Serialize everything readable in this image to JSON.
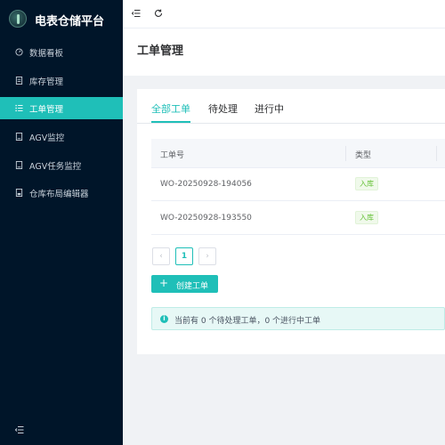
{
  "app": {
    "title": "电表仓储平台"
  },
  "sidebar": {
    "items": [
      {
        "label": "数据看板",
        "icon": "dashboard-icon",
        "active": false
      },
      {
        "label": "库存管理",
        "icon": "inventory-icon",
        "active": false
      },
      {
        "label": "工单管理",
        "icon": "list-icon",
        "active": true
      },
      {
        "label": "AGV监控",
        "icon": "monitor-icon",
        "active": false
      },
      {
        "label": "AGV任务监控",
        "icon": "task-monitor-icon",
        "active": false
      },
      {
        "label": "仓库布局编辑器",
        "icon": "layout-editor-icon",
        "active": false
      }
    ]
  },
  "page": {
    "title": "工单管理"
  },
  "tabs": [
    {
      "label": "全部工单",
      "active": true
    },
    {
      "label": "待处理",
      "active": false
    },
    {
      "label": "进行中",
      "active": false
    }
  ],
  "table": {
    "columns": [
      "工单号",
      "类型"
    ],
    "rows": [
      {
        "id": "WO-20250928-194056",
        "type": "入库"
      },
      {
        "id": "WO-20250928-193550",
        "type": "入库"
      }
    ]
  },
  "pagination": {
    "prev": "‹",
    "current": "1",
    "next": "›"
  },
  "actions": {
    "create_label": "创建工单",
    "create_plus": "+"
  },
  "alert": {
    "icon": "i",
    "text": "当前有 0 个待处理工单，0 个进行中工单"
  },
  "colors": {
    "accent": "#1fbfb8",
    "sidebar": "#001529",
    "tag": "#67c23a"
  }
}
